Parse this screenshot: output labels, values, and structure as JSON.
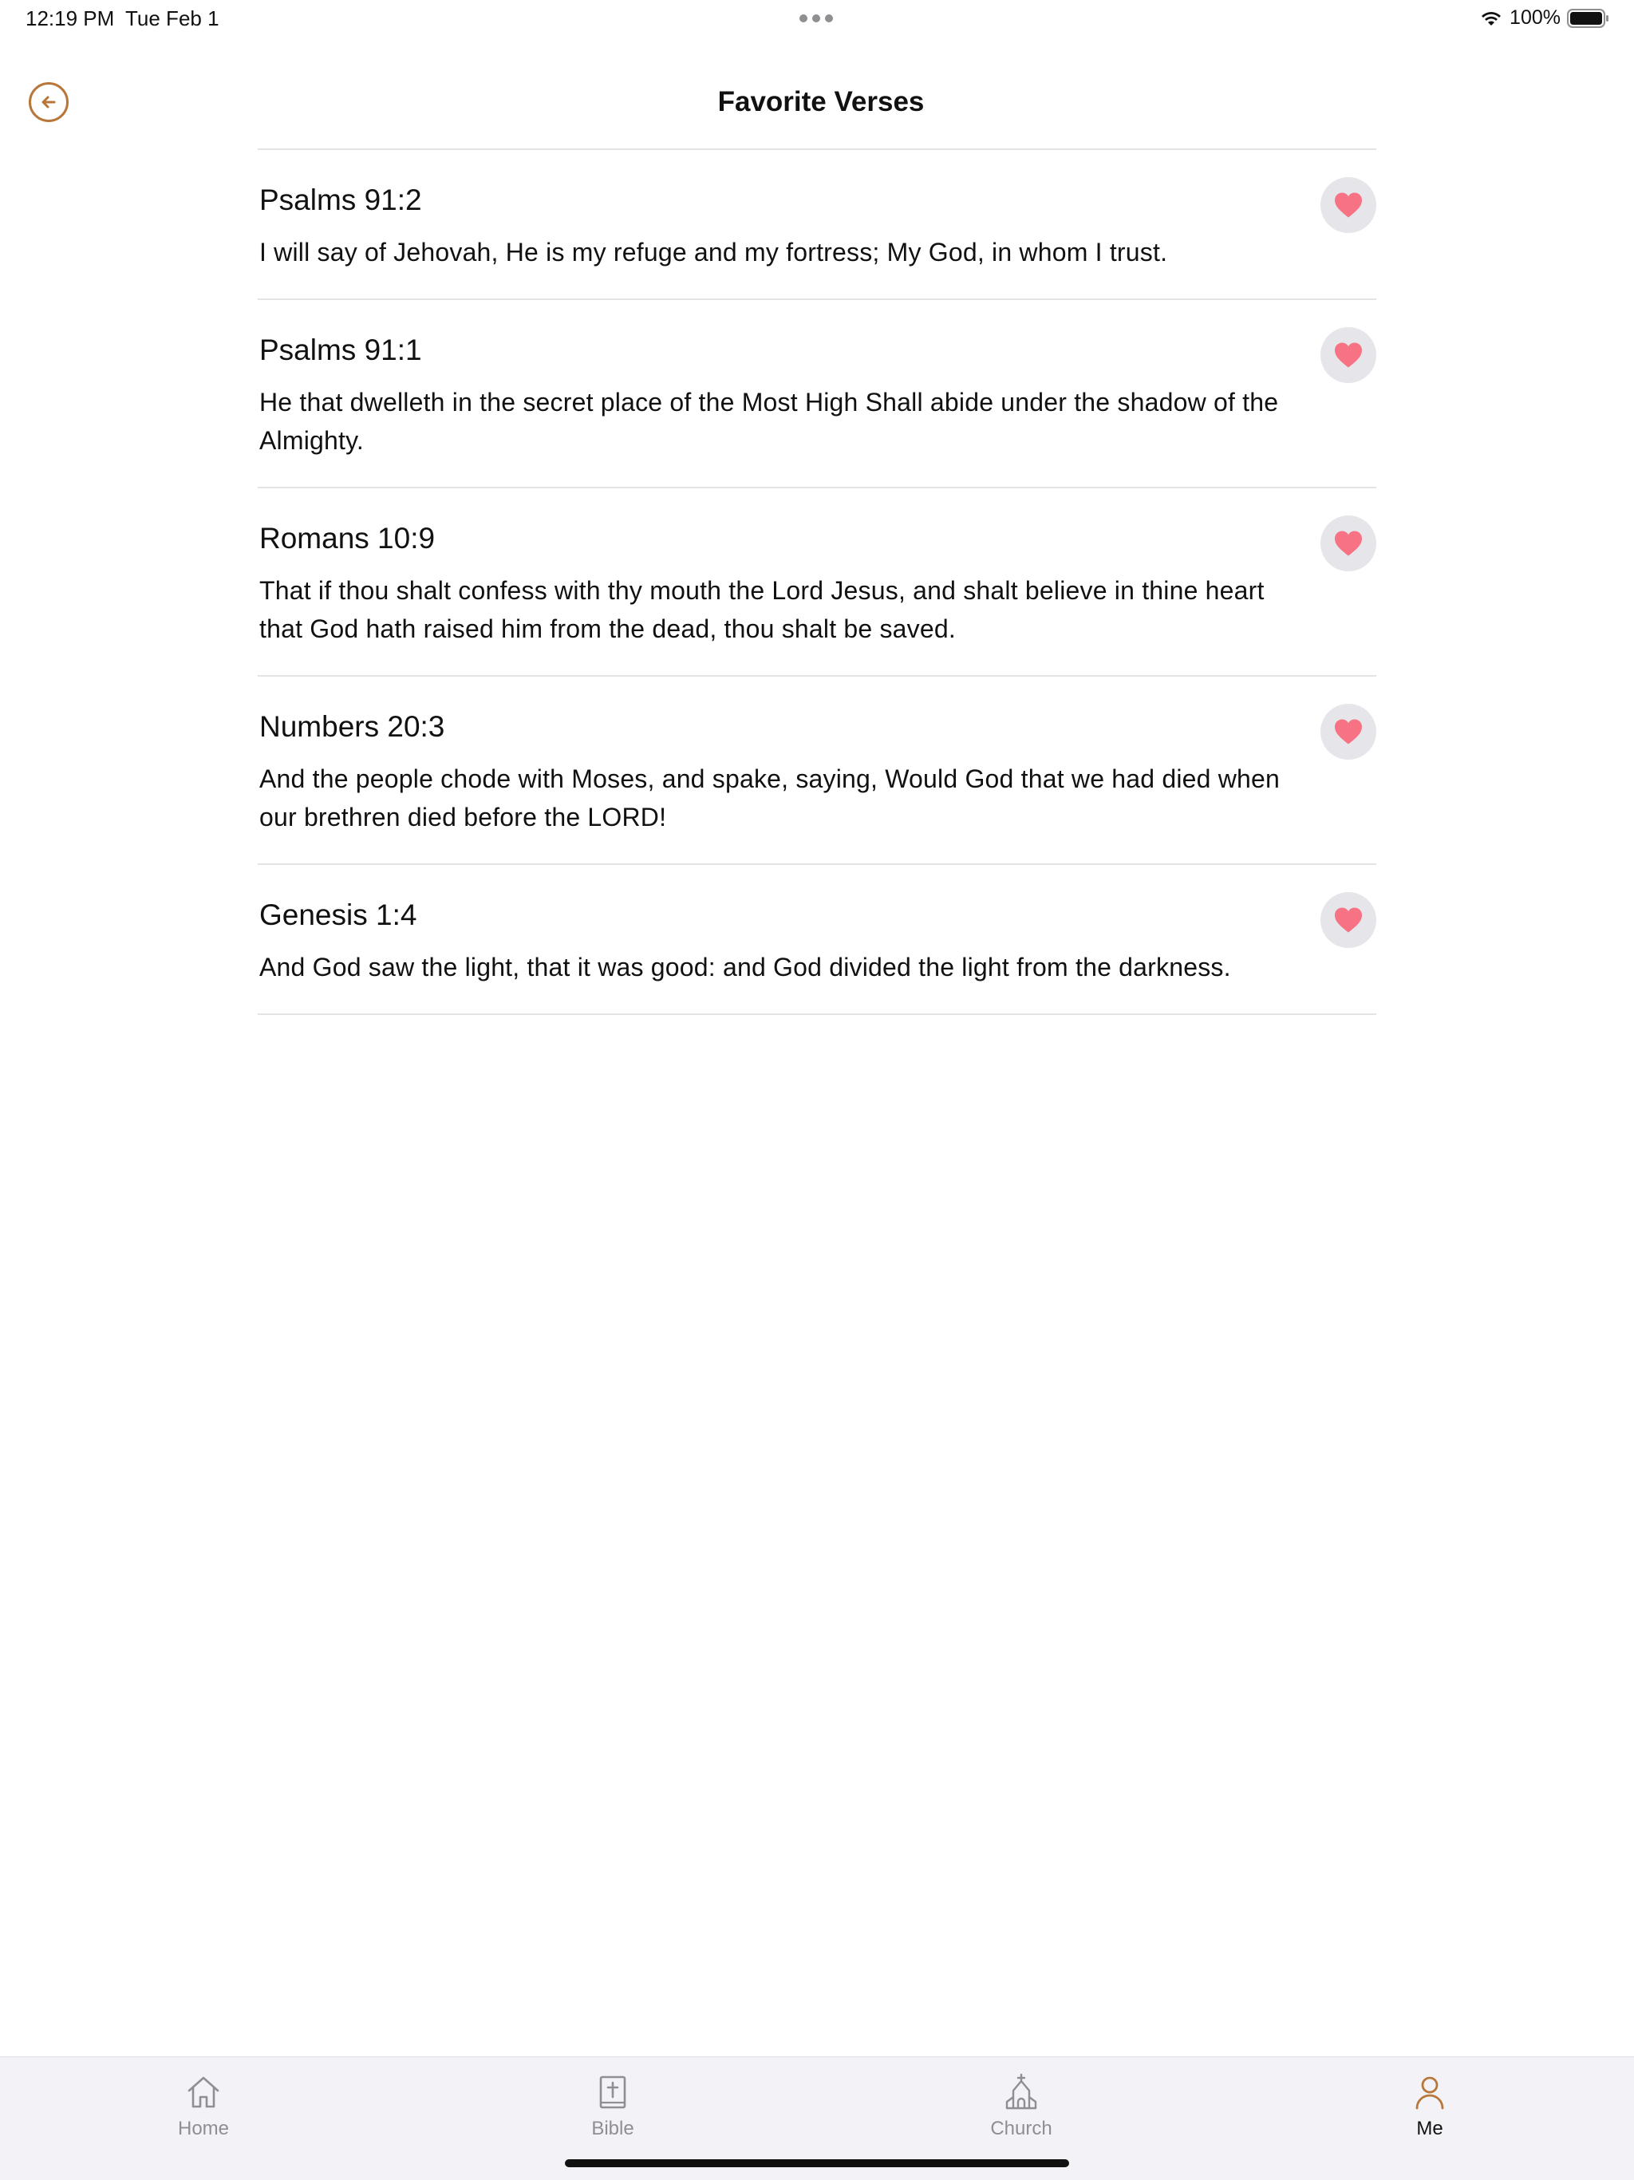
{
  "status_bar": {
    "time": "12:19 PM",
    "date": "Tue Feb 1",
    "battery": "100%",
    "icons": [
      "wifi-icon",
      "battery-icon"
    ]
  },
  "header": {
    "title": "Favorite Verses",
    "back_icon": "arrow-left-circle-icon"
  },
  "colors": {
    "accent": "#b8773a",
    "heart": "#f77383",
    "heart_bg": "#e5e5ea",
    "divider": "#e3e3e6",
    "tab_bar_bg": "#f2f2f7",
    "tab_inactive": "#8e8e93"
  },
  "verses": [
    {
      "reference": "Psalms 91:2",
      "text": "I will say of Jehovah, He is my refuge and my fortress; My God, in whom I trust.",
      "favorited": true
    },
    {
      "reference": "Psalms 91:1",
      "text": "He that dwelleth in the secret place of the Most High Shall abide under the shadow of the Almighty.",
      "favorited": true
    },
    {
      "reference": "Romans 10:9",
      "text": "That if thou shalt confess with thy mouth the Lord Jesus, and shalt believe in thine heart that God hath raised him from the dead, thou shalt be saved.",
      "favorited": true
    },
    {
      "reference": "Numbers 20:3",
      "text": "And the people chode with Moses, and spake, saying, Would God that we had died when our brethren died before the LORD!",
      "favorited": true
    },
    {
      "reference": "Genesis 1:4",
      "text": "And God saw the light, that it was good: and God divided the light from the darkness.",
      "favorited": true
    }
  ],
  "tab_bar": {
    "tabs": [
      {
        "label": "Home",
        "icon": "home-icon",
        "active": false
      },
      {
        "label": "Bible",
        "icon": "bible-icon",
        "active": false
      },
      {
        "label": "Church",
        "icon": "church-icon",
        "active": false
      },
      {
        "label": "Me",
        "icon": "person-icon",
        "active": true
      }
    ]
  }
}
